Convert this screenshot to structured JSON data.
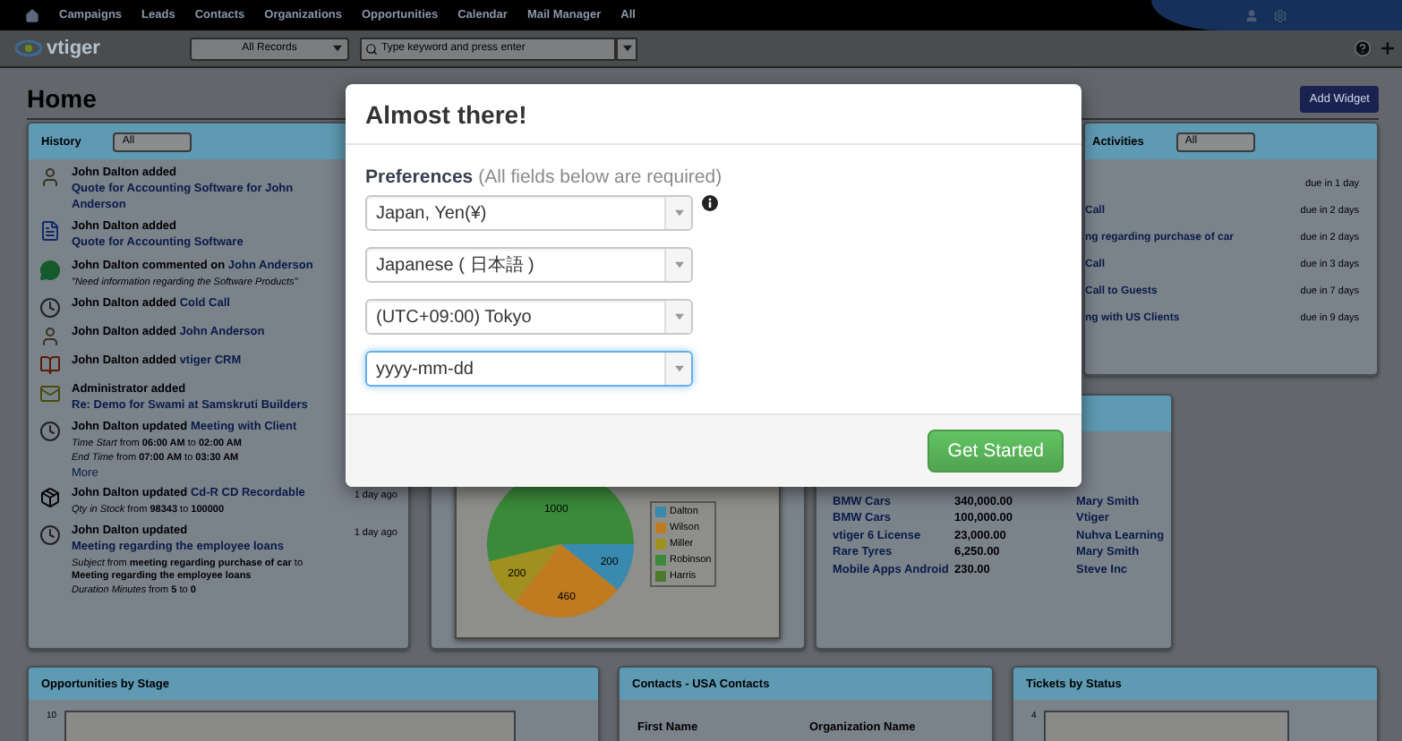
{
  "top_nav": {
    "items": [
      "Campaigns",
      "Leads",
      "Contacts",
      "Organizations",
      "Opportunities",
      "Calendar",
      "Mail Manager",
      "All"
    ]
  },
  "header": {
    "logo": "vtiger",
    "record_filter": "All Records",
    "search": {
      "placeholder": "Type keyword and press enter"
    }
  },
  "page": {
    "title": "Home",
    "add_widget": "Add Widget"
  },
  "history": {
    "title": "History",
    "filter": "All",
    "items": [
      {
        "kind": "user",
        "actor": "John Dalton added",
        "link": "Quote for Accounting Software for John Anderson"
      },
      {
        "kind": "document",
        "actor": "John Dalton added",
        "link": "Quote for Accounting Software"
      },
      {
        "kind": "comment",
        "actor": "John Dalton commented on",
        "link": "John Anderson",
        "details": [
          "*\"Need information regarding the Software Products\"*"
        ]
      },
      {
        "kind": "event",
        "actor": "John Dalton added",
        "link": "Cold Call"
      },
      {
        "kind": "user",
        "actor": "John Dalton added",
        "link": "John Anderson"
      },
      {
        "kind": "organization",
        "actor": "John Dalton added",
        "link": "vtiger CRM"
      },
      {
        "kind": "mail",
        "actor": "Administrator added",
        "link": "Re: Demo for Swami at Samskruti Builders"
      },
      {
        "kind": "event",
        "actor": "John Dalton updated",
        "link": "Meeting with Client",
        "details": [
          "*Time Start* from **06:00 AM** to **02:00 AM**",
          "*End Time* from **07:00 AM** to **03:30 AM**"
        ],
        "more": "More"
      },
      {
        "kind": "product",
        "actor": "John Dalton updated",
        "link": "Cd-R CD Recordable",
        "details": [
          "*Qty in Stock* from **98343** to **100000**"
        ],
        "time": "1 day ago"
      },
      {
        "kind": "event",
        "actor": "John Dalton updated",
        "link": "Meeting regarding the employee loans",
        "details": [
          "*Subject* from **meeting regarding purchase of car** to **Meeting regarding the employee loans**",
          "*Duration Minutes* from **5** to **0**"
        ],
        "time": "1 day ago"
      }
    ]
  },
  "activities": {
    "title": "Activities",
    "filter": "All",
    "items": [
      {
        "due": "due in 1 day"
      },
      {
        "subject": "Call",
        "due": "due in 2 days"
      },
      {
        "subject": "ng regarding purchase of car",
        "due": "due in 2 days"
      },
      {
        "subject": "Call",
        "due": "due in 3 days"
      },
      {
        "subject": "Call to Guests",
        "due": "due in 7 days"
      },
      {
        "subject": "ng with US Clients",
        "due": "due in 9 days"
      }
    ]
  },
  "pie_widget": {
    "slice_colors": [
      {
        "color": "#3a8ab0"
      },
      {
        "color": "#c07a20"
      },
      {
        "color": "#a09020"
      },
      {
        "color": "#3a8a3a"
      },
      {
        "color": "#4a7a2a"
      }
    ],
    "chart_data": {
      "type": "pie",
      "categories": [
        "Dalton",
        "Wilson",
        "Miller",
        "Robinson",
        "Harris"
      ],
      "values": [
        200,
        460,
        200,
        1000,
        null
      ],
      "data_labels": true,
      "legend": "right"
    }
  },
  "table_widget": {
    "rows": [
      [
        "BMW Cars",
        "340,000.00",
        "Mary Smith"
      ],
      [
        "BMW Cars",
        "100,000.00",
        "Vtiger"
      ],
      [
        "vtiger 6 License",
        "23,000.00",
        "Nuhva Learning"
      ],
      [
        "Rare Tyres",
        "6,250.00",
        "Mary Smith"
      ],
      [
        "Mobile Apps Android",
        "230.00",
        "Steve Inc"
      ]
    ]
  },
  "bottom_widgets": [
    {
      "kind": "chart",
      "title": "Opportunities by Stage",
      "tick": "10"
    },
    {
      "kind": "list",
      "title": "Contacts - USA Contacts",
      "columns": [
        "First Name",
        "Organization Name"
      ]
    },
    {
      "kind": "chart",
      "title": "Tickets by Status",
      "tick": "4"
    }
  ],
  "modal": {
    "title": "Almost there!",
    "section_label": "Preferences",
    "section_hint": "(All fields below are required)",
    "fields": [
      {
        "value": "Japan, Yen(¥)",
        "focused": false,
        "info": true
      },
      {
        "value": "Japanese ( 日本語 )",
        "focused": false,
        "info": false
      },
      {
        "value": "(UTC+09:00) Tokyo",
        "focused": false,
        "info": false
      },
      {
        "value": "yyyy-mm-dd",
        "focused": true,
        "info": false
      }
    ],
    "submit": "Get Started"
  }
}
